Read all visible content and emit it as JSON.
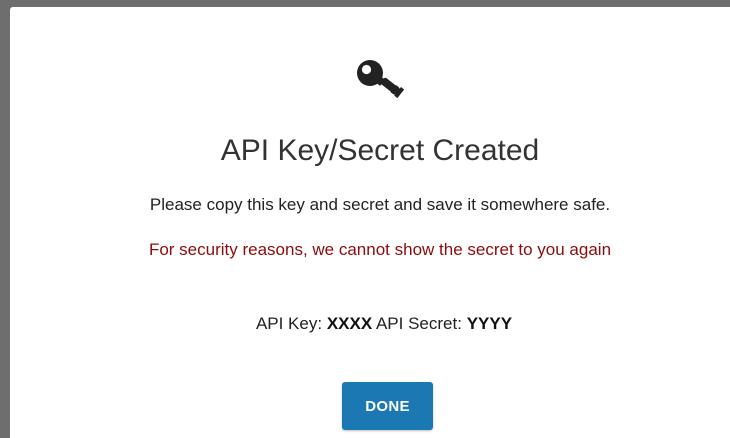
{
  "modal": {
    "icon": "key-icon",
    "title": "API Key/Secret Created",
    "instruction": "Please copy this key and secret and save it somewhere safe.",
    "warning": "For security reasons, we cannot show the secret to you again",
    "credentials": {
      "key_label": "API Key:",
      "key_value": "XXXX",
      "secret_label": "API Secret:",
      "secret_value": "YYYY"
    },
    "done_label": "DONE"
  },
  "colors": {
    "backdrop": "#6e6e6e",
    "warning_text": "#8b0c0c",
    "button_bg": "#1b78b3",
    "icon": "#222222"
  }
}
